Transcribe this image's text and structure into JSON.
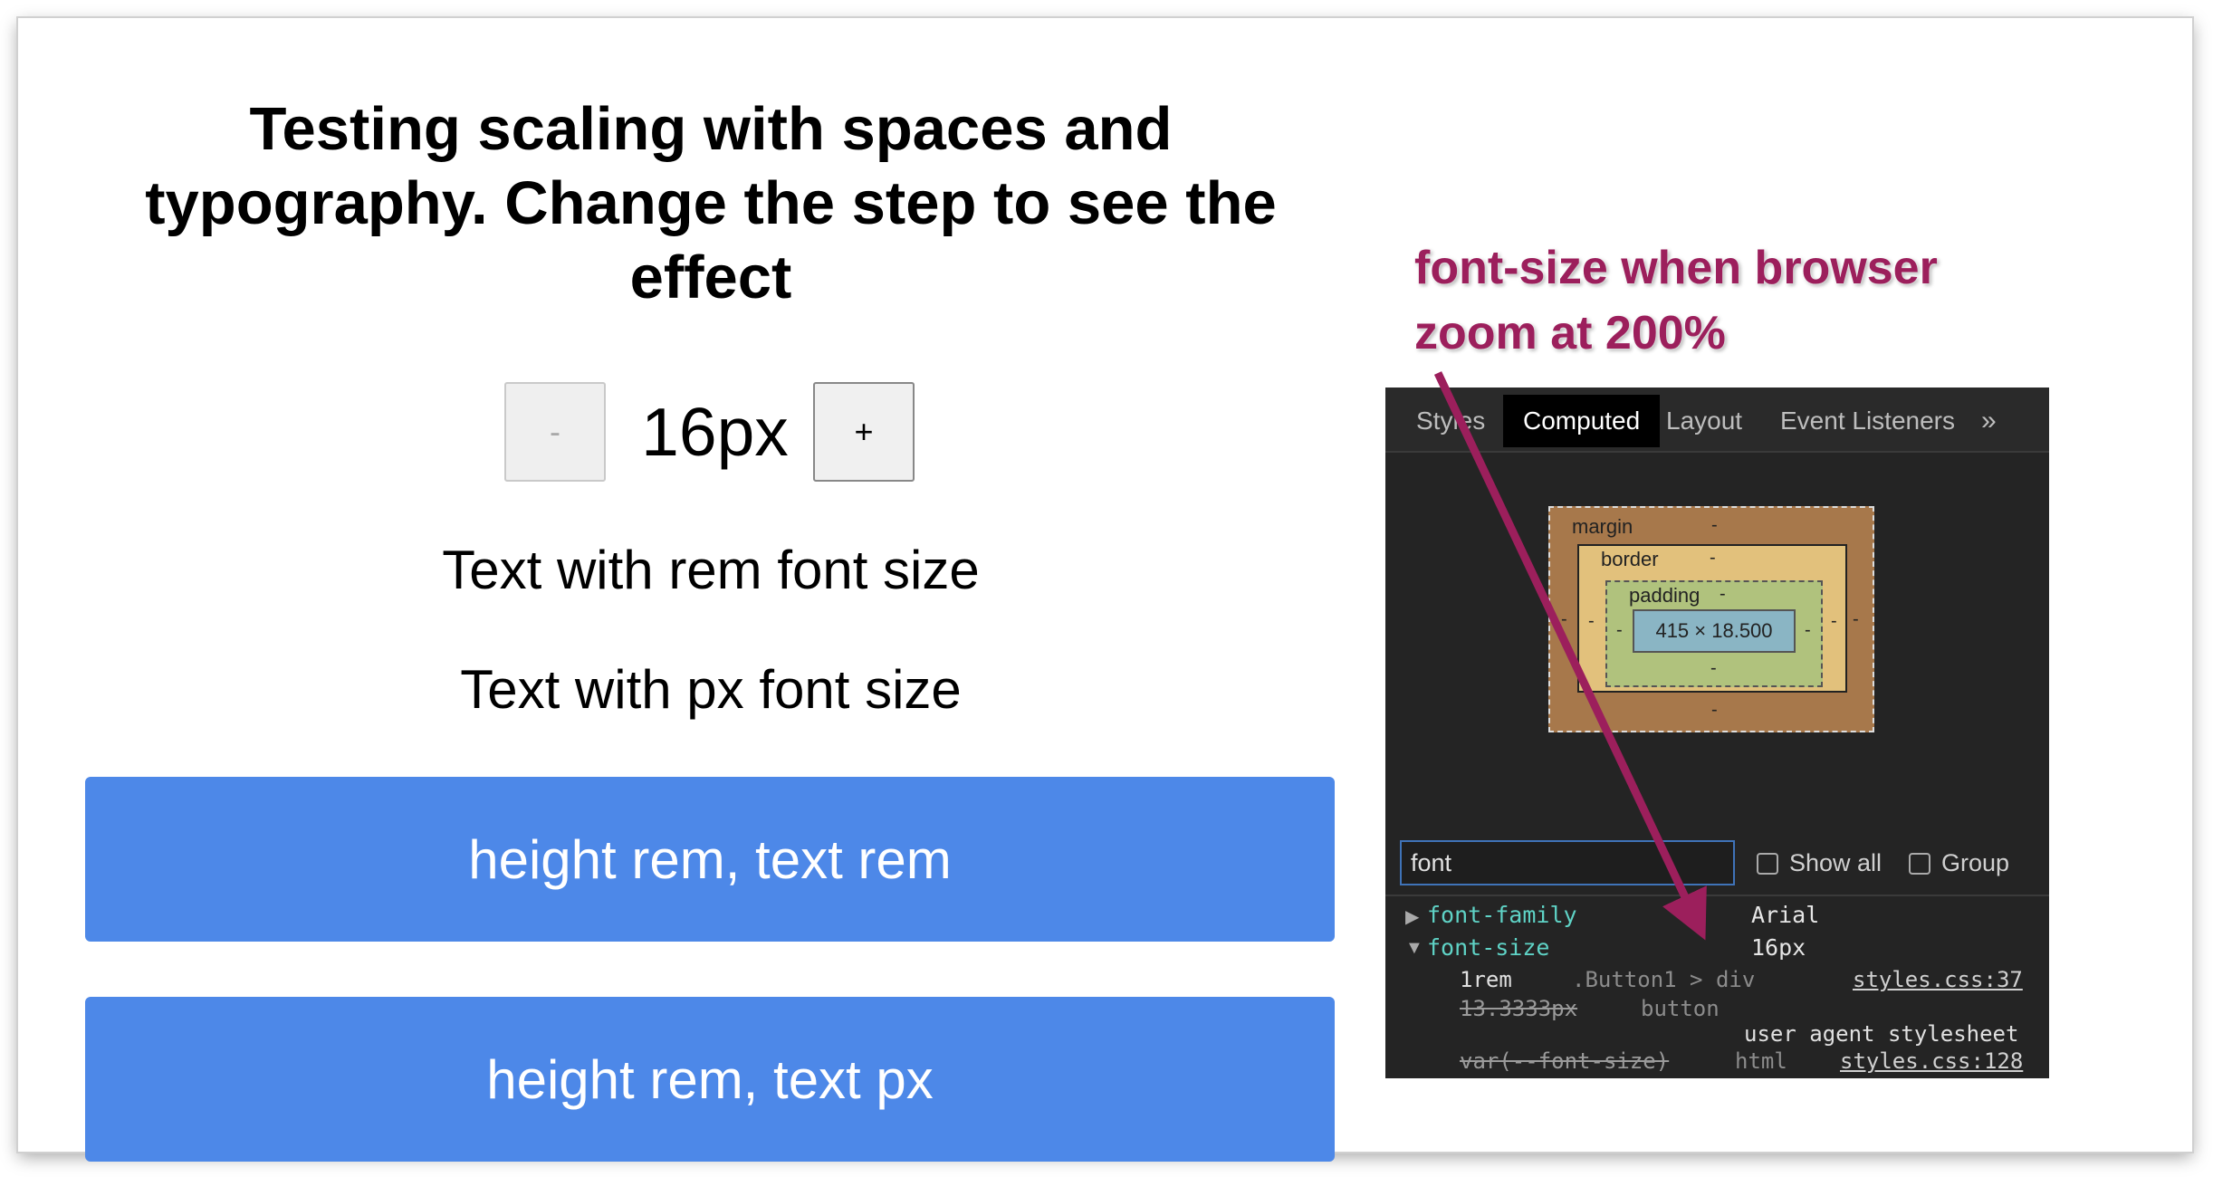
{
  "app": {
    "title": "Testing scaling with spaces and typography. Change the step to see the effect",
    "stepper": {
      "minus_label": "-",
      "value": "16px",
      "plus_label": "+"
    },
    "text_rem": "Text with rem font size",
    "text_px": "Text with px font size",
    "button1_label": "height rem, text rem",
    "button2_label": "height rem, text px",
    "colors": {
      "button": "#4d88e8",
      "annotation": "#9c1f5c"
    }
  },
  "annotation": {
    "line1": "font-size when browser",
    "line2": "zoom at 200%"
  },
  "devtools": {
    "tabs": [
      "Styles",
      "Computed",
      "Layout",
      "Event Listeners"
    ],
    "active_tab": "Computed",
    "more_icon": "chevron-double-right-icon",
    "box_model": {
      "margin_label": "margin",
      "border_label": "border",
      "padding_label": "padding",
      "dash": "-",
      "content_size": "415 × 18.500"
    },
    "filter_value": "font",
    "show_all_label": "Show all",
    "group_label": "Group",
    "properties": [
      {
        "name": "font-family",
        "value": "Arial",
        "expanded": false
      },
      {
        "name": "font-size",
        "value": "16px",
        "expanded": true
      }
    ],
    "font_size_rules": [
      {
        "value": "1rem",
        "selector": ".Button1 > div",
        "source": "styles.css:37"
      },
      {
        "value": "13.3333px",
        "selector": "button",
        "source": "user agent stylesheet"
      },
      {
        "value": "var(--font-size)",
        "selector": "html",
        "source": "styles.css:128"
      }
    ]
  }
}
